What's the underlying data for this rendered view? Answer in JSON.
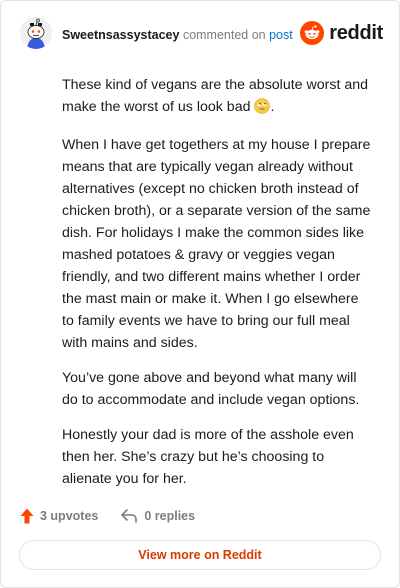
{
  "header": {
    "username": "Sweetnsassystacey",
    "commented_text": "commented on",
    "post_link": "post",
    "logo_text": "reddit"
  },
  "comment": {
    "paragraphs": [
      "These kind of vegans are the absolute worst and make the worst of us look bad",
      "When I have get togethers at my house I prepare means that are typically vegan already without alternatives (except no chicken broth instead of chicken broth), or a separate version of the same dish. For holidays I make the common sides like mashed potatoes & gravy or veggies vegan friendly, and two different mains whether I order the mast main or make it. When I go elsewhere to family events we have to bring our full meal with mains and sides.",
      "You’ve gone above and beyond what many will do to accommodate and include vegan options.",
      "Honestly your dad is more of the asshole even then her. She’s crazy but he’s choosing to alienate you for her."
    ],
    "emoji": "eye-roll-emoji",
    "emoji_suffix": "."
  },
  "actions": {
    "upvotes": "3 upvotes",
    "replies": "0 replies"
  },
  "footer": {
    "view_more": "View more on Reddit"
  },
  "colors": {
    "brand": "#ff4500",
    "link": "#0079d3",
    "view_more": "#d93a00",
    "muted": "#7c7c7c"
  }
}
